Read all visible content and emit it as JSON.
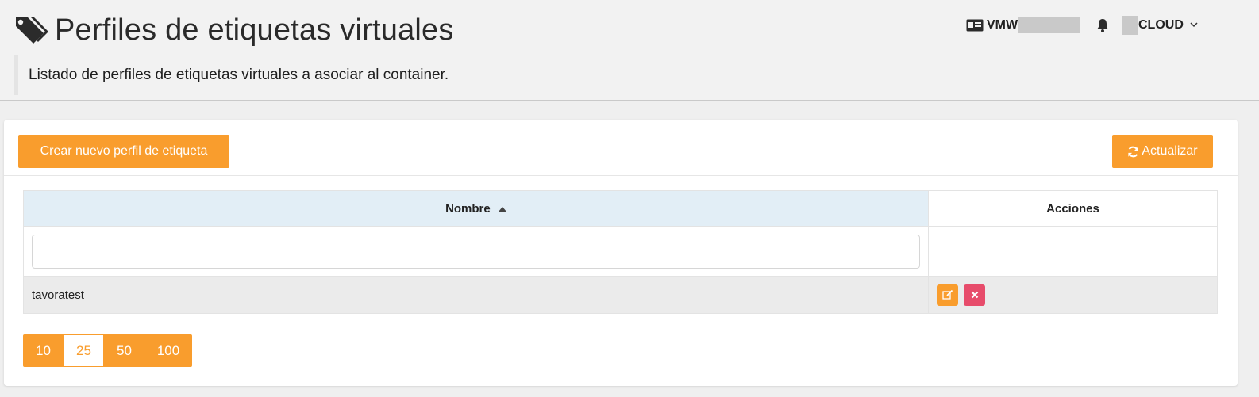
{
  "header": {
    "title": "Perfiles de etiquetas virtuales",
    "subtitle": "Listado de perfiles de etiquetas virtuales a asociar al container.",
    "tenant_prefix": "VMW",
    "user_suffix": "CLOUD"
  },
  "toolbar": {
    "create_label": "Crear nuevo perfil de etiqueta",
    "refresh_label": "Actualizar"
  },
  "table": {
    "columns": [
      "Nombre",
      "Acciones"
    ],
    "filter_value": "",
    "rows": [
      {
        "name": "tavoratest"
      }
    ]
  },
  "page_sizes": {
    "options": [
      "10",
      "25",
      "50",
      "100"
    ],
    "selected": "25"
  },
  "icons": {
    "title": "tags-icon",
    "tenant": "id-card-icon",
    "notifications": "bell-icon",
    "user_menu": "chevron-down-icon",
    "refresh": "refresh-icon",
    "sort": "sort-asc-icon",
    "edit": "edit-icon",
    "delete": "close-icon"
  },
  "colors": {
    "accent": "#f99d2d",
    "danger": "#e74c6b",
    "header_bg": "#f2f2f2",
    "table_header_bg": "#e2eef6",
    "row_bg": "#ebebeb"
  }
}
